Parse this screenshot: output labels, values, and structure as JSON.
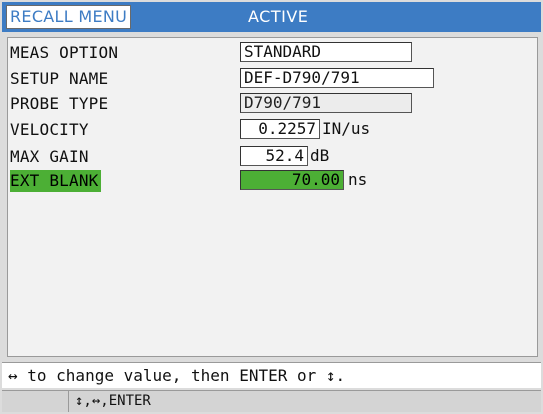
{
  "titlebar": {
    "menu_label": "RECALL MENU",
    "mode_label": "ACTIVE",
    "accent_color": "#3d7cc4",
    "highlight_color": "#4caf35"
  },
  "fields": [
    {
      "label": "MEAS OPTION",
      "value": "STANDARD",
      "unit": "",
      "editable": true
    },
    {
      "label": "SETUP NAME",
      "value": "DEF-D790/791",
      "unit": "",
      "editable": true
    },
    {
      "label": "PROBE TYPE",
      "value": "D790/791",
      "unit": "",
      "editable": false
    },
    {
      "label": "VELOCITY",
      "value": "0.2257",
      "unit": "IN/us",
      "editable": true
    },
    {
      "label": "MAX GAIN",
      "value": "52.4",
      "unit": "dB",
      "editable": true
    },
    {
      "label": "EXT BLANK",
      "value": "70.00",
      "unit": "ns",
      "editable": true,
      "selected": true
    }
  ],
  "help": {
    "instruction": "↔ to change value, then ENTER or ↕.",
    "keys": "↕,↔,ENTER"
  }
}
